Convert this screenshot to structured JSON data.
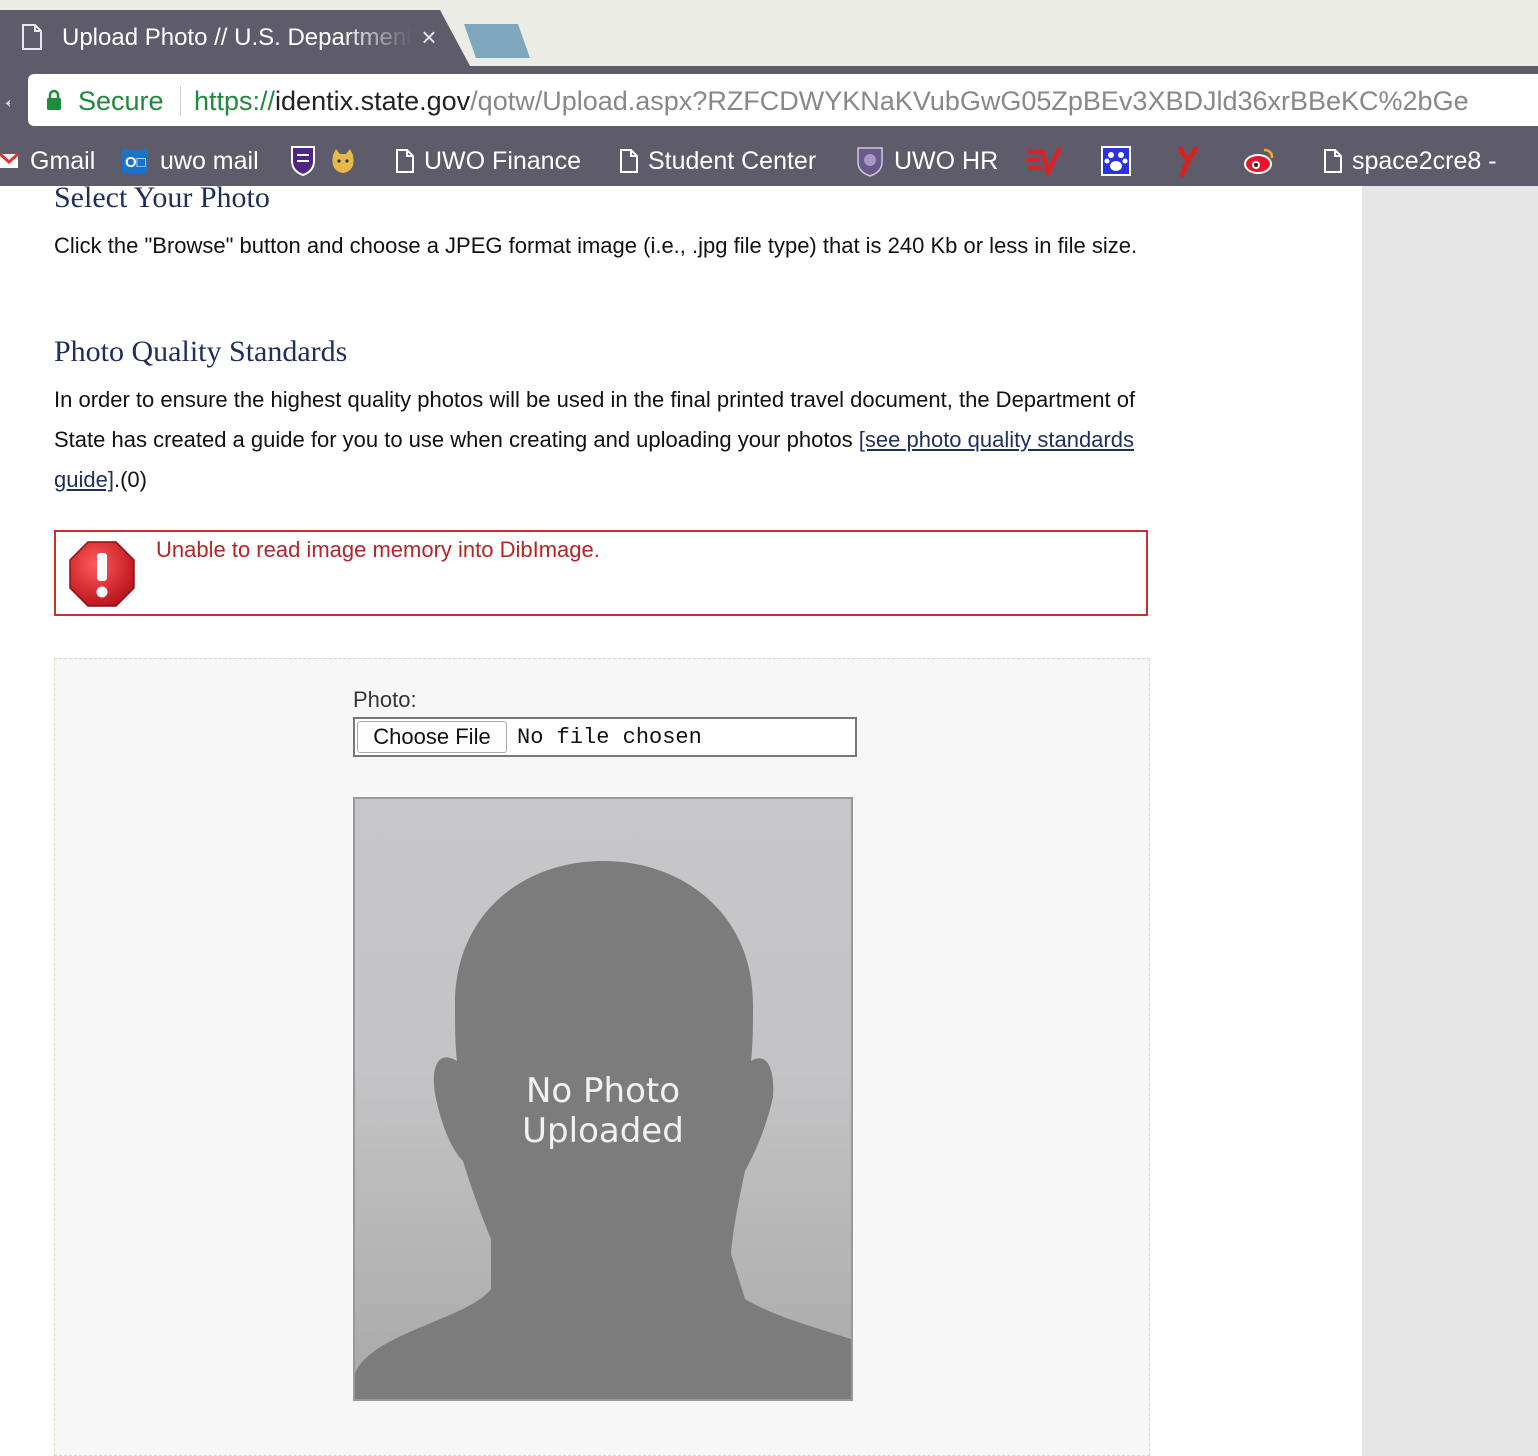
{
  "browser": {
    "tab": {
      "title": "Upload Photo // U.S. Department of State",
      "close_symbol": "×"
    },
    "omnibox": {
      "secure_label": "Secure",
      "url_scheme": "https://",
      "url_host": "identix.state.gov",
      "url_path": "/qotw/Upload.aspx?RZFCDWYKNaKVubGwG05ZpBEv3XBDJld36xrBBeKC%2bGe"
    },
    "bookmarks": [
      {
        "label": "Gmail",
        "icon": "gmail-icon"
      },
      {
        "label": "uwo mail",
        "icon": "outlook-icon"
      },
      {
        "label": "",
        "icon": "uwo-shield-icon"
      },
      {
        "label": "",
        "icon": "cat-icon"
      },
      {
        "label": "UWO Finance",
        "icon": "page-icon"
      },
      {
        "label": "Student Center",
        "icon": "page-icon"
      },
      {
        "label": "UWO HR",
        "icon": "uwo-crest-icon"
      },
      {
        "label": "",
        "icon": "expressvpn-icon"
      },
      {
        "label": "",
        "icon": "baidu-icon"
      },
      {
        "label": "",
        "icon": "yelp-icon"
      },
      {
        "label": "",
        "icon": "weibo-icon"
      },
      {
        "label": "space2cre8 -",
        "icon": "page-icon"
      }
    ]
  },
  "page": {
    "select_heading": "Select Your Photo",
    "select_text": "Click the \"Browse\" button and choose a JPEG format image (i.e., .jpg file type) that is 240 Kb or less in file size.",
    "quality_heading": "Photo Quality Standards",
    "quality_text": "In order to ensure the highest quality photos will be used in the final printed travel document, the Department of State has created a guide for you to use when creating and uploading your photos",
    "quality_link": "[see photo quality standards guide]",
    "quality_suffix": ".(0)",
    "error_message": "Unable to read image memory into DibImage.",
    "photo_label": "Photo:",
    "choose_file_label": "Choose File",
    "file_status": "No file chosen",
    "placeholder_line1": "No Photo",
    "placeholder_line2": "Uploaded"
  },
  "colors": {
    "chrome_bg": "#5e5c6a",
    "secure_green": "#1e8a3a",
    "heading_navy": "#1f2e5c",
    "error_red": "#c8302f"
  }
}
